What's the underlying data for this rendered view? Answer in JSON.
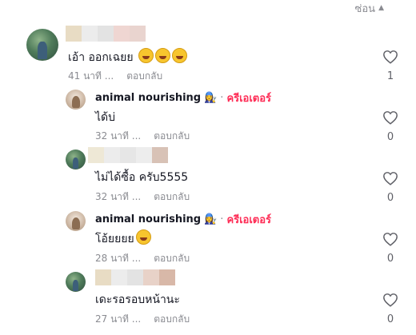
{
  "header": {
    "hide_label": "ซ่อน"
  },
  "comments": [
    {
      "username": "",
      "text": "เอ้า ออกเฉยย",
      "emoji_count": 3,
      "time": "41 นาที ...",
      "reply_label": "ตอบกลับ",
      "likes": "1"
    },
    {
      "username": "animal nourishing",
      "badge": "ครีเอเตอร์",
      "text": "ได้บ่",
      "emoji_count": 0,
      "time": "32 นาที ...",
      "reply_label": "ตอบกลับ",
      "likes": "0"
    },
    {
      "username": "",
      "text": "ไม่ได้ซื้อ ครับ5555",
      "emoji_count": 0,
      "time": "32 นาที ...",
      "reply_label": "ตอบกลับ",
      "likes": "0"
    },
    {
      "username": "animal nourishing",
      "badge": "ครีเอเตอร์",
      "text": "โอ้ยยยย",
      "emoji_count": 1,
      "time": "28 นาที ...",
      "reply_label": "ตอบกลับ",
      "likes": "0"
    },
    {
      "username": "",
      "text": "เดะรอรอบหน้านะ",
      "emoji_count": 0,
      "time": "27 นาที ...",
      "reply_label": "ตอบกลับ",
      "likes": "0"
    }
  ],
  "colors": {
    "creator": "#fe2c55",
    "muted": "#8a8b91",
    "text": "#161823"
  },
  "icons": {
    "like": "heart-outline-icon",
    "hide": "chevron-up-icon",
    "laugh": "rolling-on-floor-laughing-emoji"
  }
}
